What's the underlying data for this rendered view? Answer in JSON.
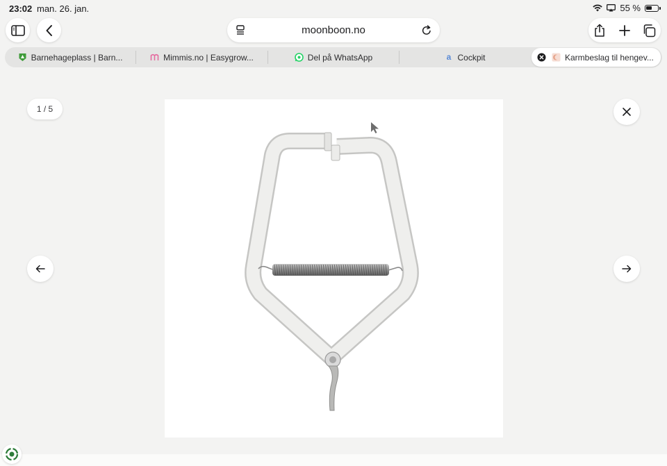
{
  "status_bar": {
    "time": "23:02",
    "date": "man. 26. jan.",
    "battery_percent": "55 %",
    "battery_level": 0.55
  },
  "browser": {
    "address": "moonboon.no",
    "icons": {
      "sidebar": "sidebar-icon",
      "back": "chevron-left-icon",
      "reader": "page-menu-icon",
      "reload": "reload-icon",
      "share": "share-icon",
      "new_tab": "plus-icon",
      "tabs": "tabs-overview-icon"
    }
  },
  "tabs": [
    {
      "title": "Barnehageplass | Barn...",
      "favicon": "green-shield-favicon",
      "active": false
    },
    {
      "title": "Mimmis.no | Easygrow...",
      "favicon": "pink-m-favicon",
      "active": false
    },
    {
      "title": "Del på WhatsApp",
      "favicon": "whatsapp-favicon",
      "active": false
    },
    {
      "title": "Cockpit",
      "favicon": "blue-a-favicon",
      "active": false
    },
    {
      "title": "Karmbeslag til hengev...",
      "favicon": "moon-favicon",
      "active": true
    }
  ],
  "gallery": {
    "counter": "1 / 5",
    "current_index": 1,
    "total": 5,
    "image_subject": "white door frame bracket with spring",
    "icons": {
      "close": "close-icon",
      "prev": "arrow-left-icon",
      "next": "arrow-right-icon"
    }
  },
  "colors": {
    "page_background": "#f3f3f2",
    "tabbar_background": "#e4e4e3",
    "text_primary": "#1c1c1e",
    "button_background": "#ffffff"
  }
}
